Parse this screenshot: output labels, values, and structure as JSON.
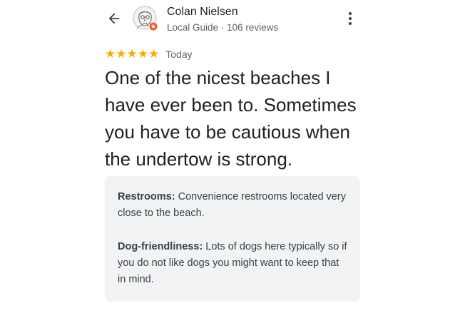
{
  "header": {
    "back_icon": "arrow-back-icon",
    "more_icon": "more-vert-icon"
  },
  "reviewer": {
    "name": "Colan Nielsen",
    "meta": "Local Guide · 106 reviews",
    "avatar_icon": "sketch-portrait-avatar",
    "badge_color": "#f4511e"
  },
  "review": {
    "rating": 5,
    "max_rating": 5,
    "star_color": "#f9ab00",
    "date": "Today",
    "text": "One of the nicest beaches I have ever been to. Sometimes you have to be cautious when the undertow is strong."
  },
  "attributes": [
    {
      "label": "Restrooms:",
      "value": " Convenience restrooms located very close to the beach."
    },
    {
      "label": "Dog-friendliness:",
      "value": " Lots of dogs here typically so if you do not like dogs you might want to keep that in mind."
    }
  ]
}
